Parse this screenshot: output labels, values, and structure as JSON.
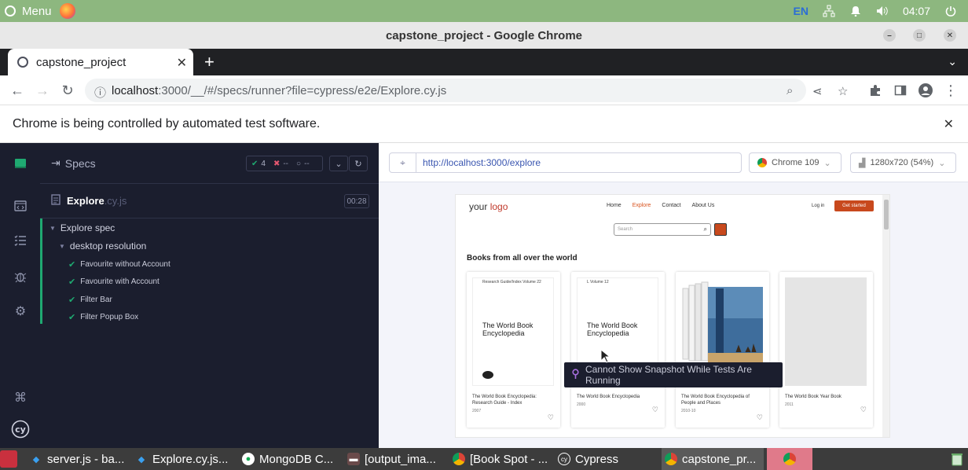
{
  "os_bar": {
    "menu_label": "Menu",
    "language": "EN",
    "clock": "04:07"
  },
  "window": {
    "title": "capstone_project - Google Chrome"
  },
  "tabs": [
    {
      "label": "capstone_project",
      "active": true
    }
  ],
  "address_bar": {
    "url_host": "localhost",
    "url_path": ":3000/__/#/specs/runner?file=cypress/e2e/Explore.cy.js"
  },
  "infobar": {
    "message": "Chrome is being controlled by automated test software."
  },
  "cypress": {
    "specs_label": "Specs",
    "stats": {
      "passed": "4",
      "failed": "--",
      "pending": "--"
    },
    "spec_file": {
      "name": "Explore",
      "ext": ".cy.js",
      "duration": "00:28"
    },
    "suite": "Explore spec",
    "context": "desktop resolution",
    "tests": [
      "Favourite without Account",
      "Favourite with Account",
      "Filter Bar",
      "Filter Popup Box"
    ],
    "aut_url": "http://localhost:3000/explore",
    "browser": "Chrome 109",
    "viewport": "1280x720 (54%)",
    "snapshot_message": "Cannot Show Snapshot While Tests Are Running"
  },
  "app_page": {
    "logo_text": "your",
    "logo_accent": "logo",
    "nav": [
      "Home",
      "Explore",
      "Contact",
      "About Us"
    ],
    "active_nav": "Explore",
    "login": "Log in",
    "cta": "Get started",
    "search_placeholder": "Search",
    "heading": "Books from all over the world",
    "books": [
      {
        "title": "The World Book Encyclopedia: Research Guide - Index",
        "year": "2007",
        "cover_title": "The World Book Encyclopedia",
        "cover_sub": "Research Guide/Index     Volume 22"
      },
      {
        "title": "The World Book Encyclopedia",
        "year": "2000",
        "cover_title": "The World Book Encyclopedia",
        "cover_sub": "L    Volume 12"
      },
      {
        "title": "The World Book Encyclopedia of People and Places",
        "year": "2010-10",
        "cover_title": "",
        "cover_sub": ""
      },
      {
        "title": "The World Book Year Book",
        "year": "2011",
        "cover_title": "",
        "cover_sub": ""
      }
    ]
  },
  "taskbar": [
    {
      "label": "server.js - ba...",
      "icon": "vscode-icon"
    },
    {
      "label": "Explore.cy.js...",
      "icon": "vscode-icon"
    },
    {
      "label": "MongoDB C...",
      "icon": "mongodb-icon"
    },
    {
      "label": "[output_ima...",
      "icon": "folder-icon"
    },
    {
      "label": "[Book Spot - ...",
      "icon": "chrome-icon"
    },
    {
      "label": "Cypress",
      "icon": "cypress-icon"
    },
    {
      "label": "capstone_pr...",
      "icon": "chrome-icon"
    }
  ],
  "colors": {
    "os_bar": "#8db77f",
    "cypress_bg": "#1b1e2e",
    "pass": "#1fa971",
    "accent": "#c8491d"
  }
}
